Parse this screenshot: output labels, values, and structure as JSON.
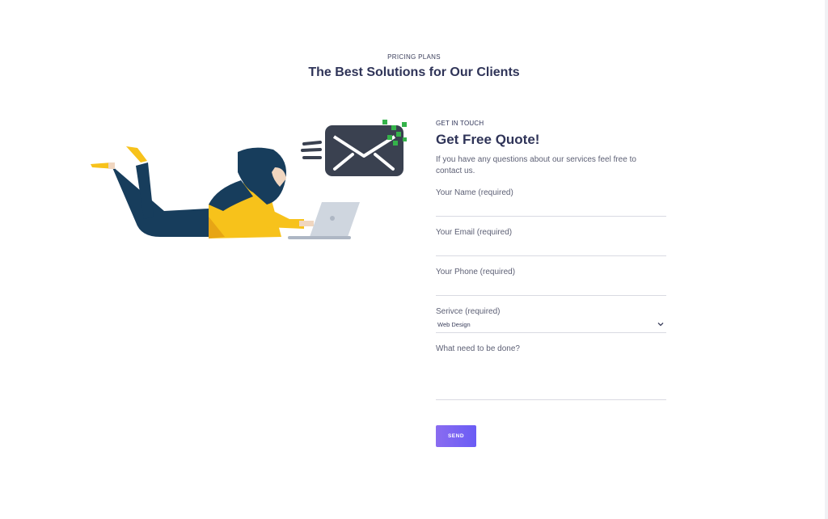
{
  "section": {
    "eyebrow": "PRICING PLANS",
    "title": "The Best Solutions for Our Clients"
  },
  "form": {
    "eyebrow": "GET IN TOUCH",
    "title": "Get Free Quote!",
    "description": "If you have any questions about our services feel free to contact us.",
    "fields": {
      "name": {
        "label": "Your Name (required)",
        "value": ""
      },
      "email": {
        "label": "Your Email (required)",
        "value": ""
      },
      "phone": {
        "label": "Your Phone (required)",
        "value": ""
      },
      "service": {
        "label": "Serivce (required)",
        "selected": "Web Design"
      },
      "message": {
        "label": "What need to be done?",
        "value": ""
      }
    },
    "send_label": "SEND"
  },
  "illustration": {
    "subject": "woman-with-laptop-and-envelope",
    "icon": "envelope-icon"
  },
  "colors": {
    "heading": "#2f3458",
    "body_text": "#5d6075",
    "accent_button": "#7b64f2",
    "envelope": "#3a4150",
    "pixel_green": "#34b34a",
    "shirt_yellow": "#f7c21b",
    "hair_navy": "#173d5c"
  }
}
